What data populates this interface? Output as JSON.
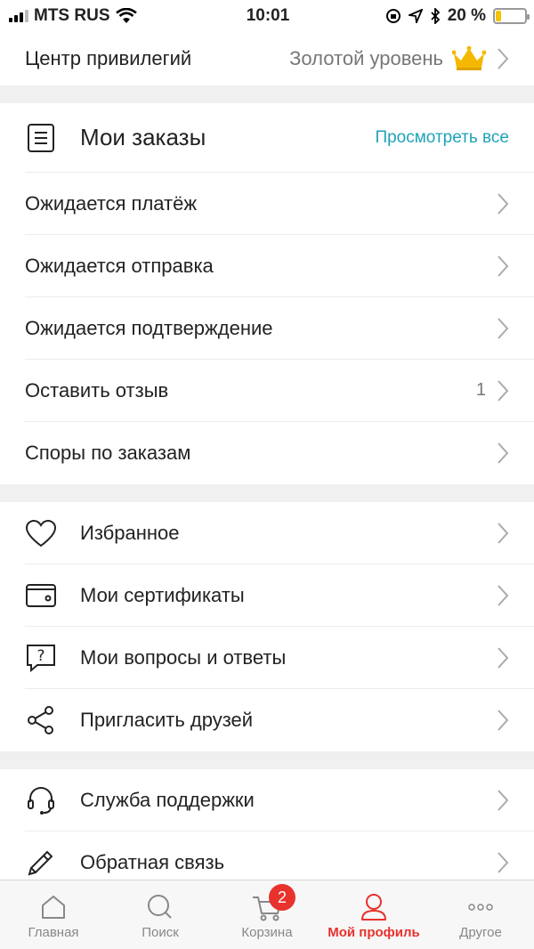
{
  "status_bar": {
    "carrier": "MTS RUS",
    "time": "10:01",
    "battery": "20 %",
    "battery_level": 0.2
  },
  "privileges": {
    "label": "Центр привилегий",
    "level": "Золотой уровень"
  },
  "orders": {
    "title": "Мои заказы",
    "view_all": "Просмотреть все",
    "items": [
      {
        "label": "Ожидается платёж"
      },
      {
        "label": "Ожидается отправка"
      },
      {
        "label": "Ожидается подтверждение"
      },
      {
        "label": "Оставить отзыв",
        "count": "1"
      },
      {
        "label": "Споры по заказам"
      }
    ]
  },
  "menu": {
    "items": [
      {
        "label": "Избранное",
        "icon": "heart-icon"
      },
      {
        "label": "Мои сертификаты",
        "icon": "wallet-icon"
      },
      {
        "label": "Мои вопросы и ответы",
        "icon": "question-bubble-icon"
      },
      {
        "label": "Пригласить друзей",
        "icon": "share-icon"
      }
    ]
  },
  "support": {
    "items": [
      {
        "label": "Служба поддержки",
        "icon": "headset-icon"
      },
      {
        "label": "Обратная связь",
        "icon": "pencil-icon"
      }
    ]
  },
  "tabbar": {
    "tabs": [
      {
        "label": "Главная",
        "icon": "home-icon"
      },
      {
        "label": "Поиск",
        "icon": "search-icon"
      },
      {
        "label": "Корзина",
        "icon": "cart-icon",
        "badge": "2"
      },
      {
        "label": "Мой профиль",
        "icon": "profile-icon",
        "active": true
      },
      {
        "label": "Другое",
        "icon": "more-icon"
      }
    ]
  },
  "colors": {
    "accent": "#e8322d",
    "link": "#1fa3b8",
    "gold": "#f5b800"
  }
}
